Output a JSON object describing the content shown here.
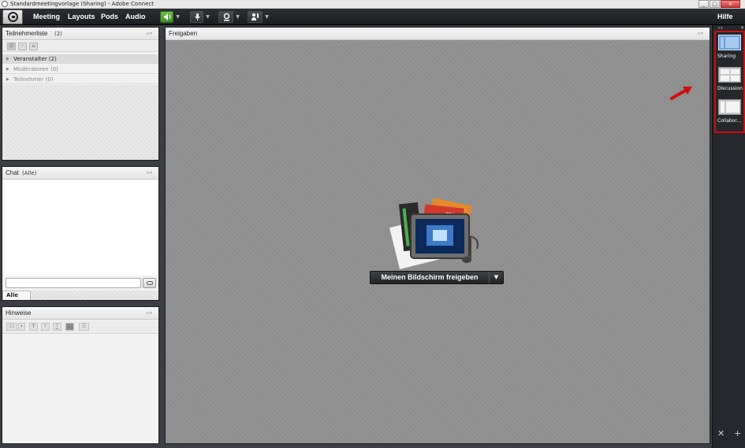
{
  "window": {
    "title": "Standardmeetingvorlage (Sharing) - Adobe Connect",
    "controls": [
      "_",
      "□",
      "×"
    ]
  },
  "menubar": {
    "items": [
      "Meeting",
      "Layouts",
      "Pods",
      "Audio"
    ],
    "help": "Hilfe",
    "icons": [
      "speaker-icon",
      "microphone-icon",
      "webcam-icon",
      "raise-hand-icon"
    ],
    "accent": "#4fa232"
  },
  "attendees_pod": {
    "title": "Teilnehmerliste",
    "count": "(2)",
    "categories": [
      {
        "label": "Veranstalter (2)"
      },
      {
        "label": "Moderatoren (0)"
      },
      {
        "label": "Teilnehmer (0)"
      }
    ]
  },
  "chat_pod": {
    "title": "Chat",
    "scope": "(Alle)",
    "input_value": "",
    "tab_label": "Alle"
  },
  "notes_pod": {
    "title": "Hinweise",
    "font_size": "11"
  },
  "share_pod": {
    "title": "Freigaben",
    "share_button_label": "Meinen Bildschirm freigeben",
    "doc_tags": [
      "PPT",
      "PDF"
    ]
  },
  "layouts_bar": {
    "items": [
      {
        "label": "Sharing",
        "active": true
      },
      {
        "label": "Discussion",
        "active": false
      },
      {
        "label": "Collabor...",
        "active": false
      }
    ],
    "highlight_color": "#d10c0c"
  }
}
